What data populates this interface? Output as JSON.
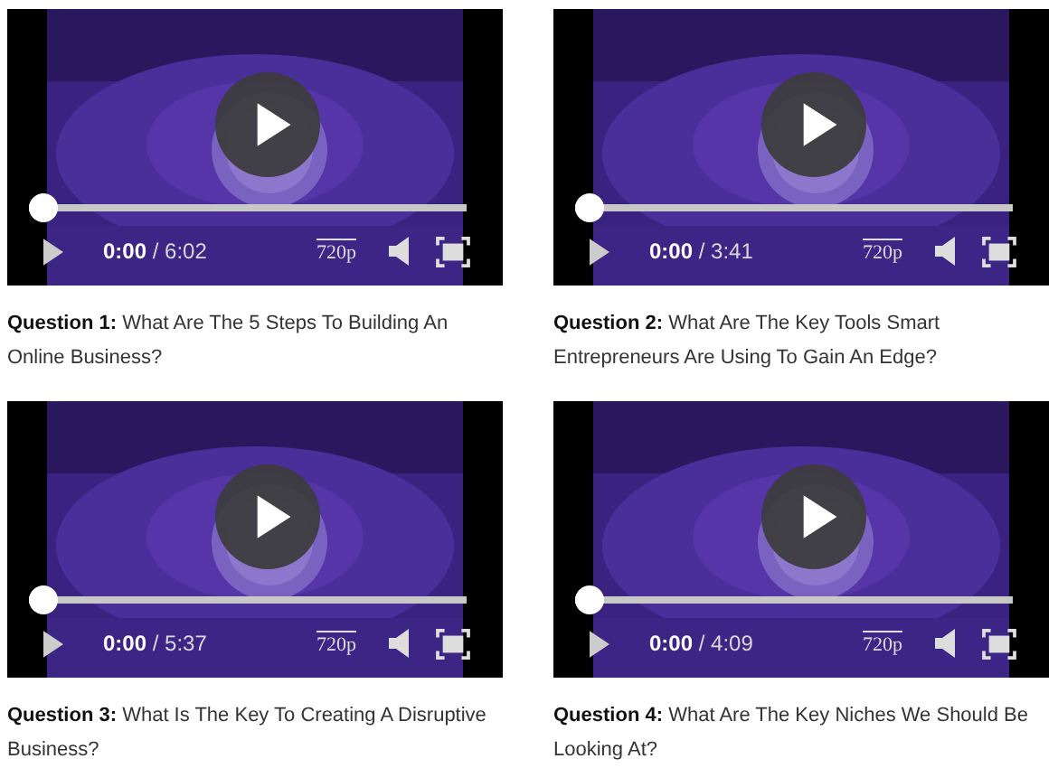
{
  "videos": [
    {
      "time": "**0:00** / 6:02",
      "quality": "720p",
      "progress": {
        "level": 0
      },
      "caption": "**Question 1:** What Are The 5 Steps To Building An Online Business?"
    },
    {
      "time": "**0:00** / 3:41",
      "quality": "720p",
      "progress": {
        "level": 0
      },
      "caption": "**Question 2:** What Are The Key Tools Smart Entrepreneurs Are Using To Gain An Edge?"
    },
    {
      "time": "**0:00** / 5:37",
      "quality": "720p",
      "progress": {
        "level": 0
      },
      "caption": "**Question 3:** What Is The Key To Creating A Disruptive Business?"
    },
    {
      "time": "**0:00** / 4:09",
      "quality": "720p",
      "progress": {
        "level": 0
      },
      "caption": "**Question 4:** What Are The Key Niches We Should Be Looking At?"
    }
  ]
}
